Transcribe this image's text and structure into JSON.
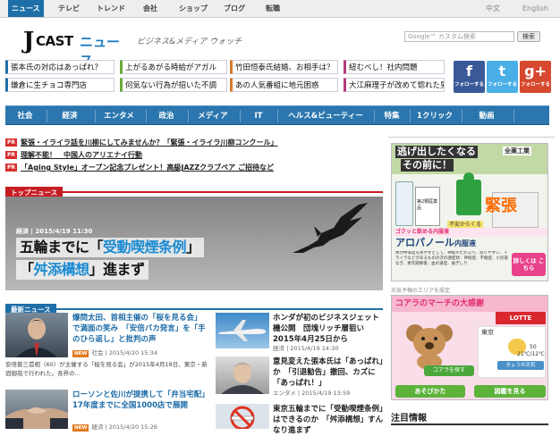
{
  "topnav": {
    "items": [
      "ニュース",
      "テレビ",
      "トレンド",
      "会社",
      "ショップ",
      "ブログ",
      "転職"
    ],
    "langs": [
      "中文",
      "English"
    ]
  },
  "logo": {
    "j": "J",
    "cast": "CAST",
    "news": "ニュース"
  },
  "tagline": "ビジネス&メディア ウォッチ",
  "search": {
    "placeholder": "Google™ カスタム検索",
    "button": "検索"
  },
  "tags": [
    "張本氏の対応はあっぱれ？",
    "上がるあがる時給がアガル",
    "竹田恒泰氏結婚、お相手は？",
    "紐むべし！社内問題",
    "鎌倉に生チョコ専門店",
    "何気ない行為が招いた不調",
    "あの人気番組に地元困惑",
    "大江麻理子が改めて惚れた男"
  ],
  "social": [
    {
      "glyph": "f",
      "label": "フォローする",
      "color": "#3b5998"
    },
    {
      "glyph": "t",
      "label": "フォローする",
      "color": "#4aaee7"
    },
    {
      "glyph": "g+",
      "label": "フォローする",
      "color": "#d6492f"
    }
  ],
  "mainnav": [
    "社会",
    "経済",
    "エンタメ",
    "政治",
    "メディア",
    "IT",
    "ヘルス&ビューティー",
    "特集",
    "1クリック",
    "動画"
  ],
  "pr": [
    {
      "badge": "PR",
      "text": "緊張・イライラ話を川柳にしてみませんか？「緊張・イライラ川柳コンクール」"
    },
    {
      "badge": "PR",
      "text": "理解不能！　中国人のアリエナイ行動"
    },
    {
      "badge": "PR",
      "text": "「Aging Style」オープン記念プレゼント！高級JAZZクラブペア ご招待など"
    }
  ],
  "top_news": {
    "header": "トップニュース",
    "date": "経済 | 2015/4/19 11:30",
    "line1_pre": "五輪までに「",
    "line1_hl": "受動喫煙条例",
    "line1_post": "」",
    "line2_pre": "「",
    "line2_hl": "舛添構想",
    "line2_post": "」進まず"
  },
  "latest": {
    "header": "最新ニュース",
    "items": [
      {
        "title_hl": "爆問太田、首相主催の「桜を見る会」で満面の笑み　「安倍バカ発言」を「手のひら返し」と批判の声",
        "new": "NEW",
        "meta": "社会 | 2015/4/20 15:34",
        "desc": "安倍晋三首相（60）が主催する「桜を見る会」が2015年4月18日、東京・新宿御苑で行われた。各界の..."
      },
      {
        "title_hl": "ローソンと佐川が提携して「弁当宅配」17年度までに全国1000店で展開",
        "new": "NEW",
        "meta": "経済 | 2015/4/20 15:26"
      },
      {
        "title": "ホンダが初のビジネスジェット機公開　団塊リッチ層狙い2015年4月25日から",
        "meta": "経済 | 2015/4/19 14:30"
      },
      {
        "title": "意見変えた張本氏は「あっぱれ」か　「引退勧告」撤回、カズに「あっぱれ！」",
        "meta": "エンタメ | 2015/4/19 13:59"
      },
      {
        "title": "東京五輪までに「受動喫煙条例」はできるのか　「舛添構想」すんなり進まず",
        "meta": ""
      }
    ]
  },
  "ad1": {
    "headline": "逃げ出したくなる",
    "headline2": "その前に！",
    "brand": "全薬工業",
    "tension": "緊張",
    "product": "アロパノール",
    "product_suffix": "内服液",
    "button": "詳しくは こちら",
    "sub": "不安からくる",
    "tag1": "第2類医薬品",
    "drink": "ゴクッと飲める内服液",
    "fine": "体力中等度をめやすとして、神経がたかぶり、怒りやすい、イライラなどがあるものの次の諸症状：神経症、不眠症、小児夜なき、更年期障害、血の道症、歯ぎしり"
  },
  "ad2": {
    "top_note": "天気予報のエリアを設定",
    "title": "コアラのマーチの大感謝",
    "city": "東京",
    "pct": "50",
    "temp": "21℃/12℃",
    "weather": "きょうの天気",
    "btn_search": "コアラを探す",
    "btn_play": "あそびかた",
    "btn_goods": "図鑑を見る",
    "brand": "LOTTE"
  },
  "chumoku": "注目情報"
}
